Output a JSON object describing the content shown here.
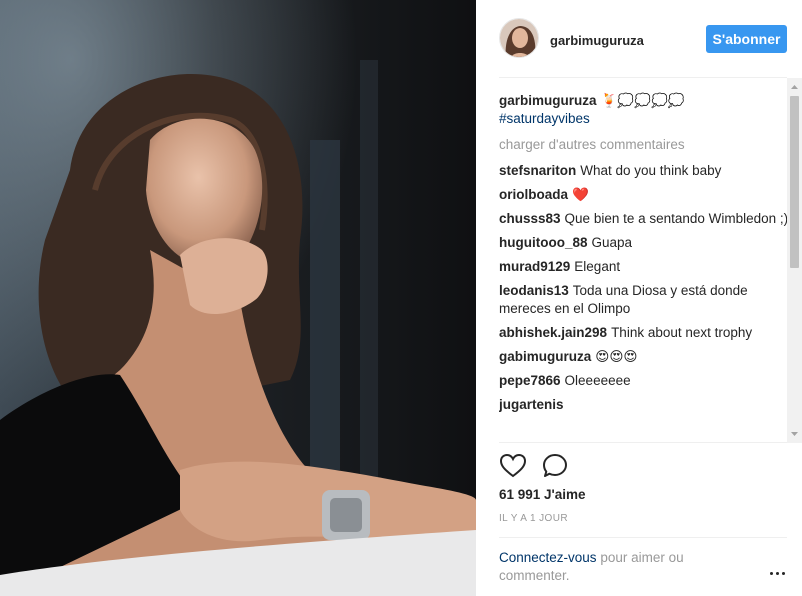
{
  "header": {
    "username": "garbimuguruza",
    "follow_label": "S'abonner"
  },
  "caption": {
    "username": "garbimuguruza",
    "emoji": "🍹💭💭💭💭",
    "hashtag": "#saturdayvibes"
  },
  "load_more_label": "charger d'autres commentaires",
  "comments": [
    {
      "username": "stefsnariton",
      "text": "What do you think baby"
    },
    {
      "username": "oriolboada",
      "text": "❤️"
    },
    {
      "username": "chusss83",
      "text": "Que bien te a sentando Wimbledon ;)"
    },
    {
      "username": "huguitooo_88",
      "text": "Guapa"
    },
    {
      "username": "murad9129",
      "text": "Elegant"
    },
    {
      "username": "leodanis13",
      "text": "Toda una Diosa y está donde mereces en el Olimpo"
    },
    {
      "username": "abhishek.jain298",
      "text": "Think about next trophy"
    },
    {
      "username": "gabimuguruza",
      "text": "😍😍😍"
    },
    {
      "username": "pepe7866",
      "text": "Oleeeeeee"
    },
    {
      "username": "jugartenis",
      "text": ""
    }
  ],
  "likes_label": "61 991 J'aime",
  "timestamp": "IL Y A 1 JOUR",
  "login_prompt": {
    "link": "Connectez-vous",
    "rest": " pour aimer ou commenter."
  },
  "icons": {
    "like": "heart-outline-icon",
    "comment": "comment-bubble-icon",
    "more": "more-options-icon"
  },
  "colors": {
    "follow_button": "#3897f0",
    "hashtag": "#003569",
    "muted_text": "#999999"
  }
}
